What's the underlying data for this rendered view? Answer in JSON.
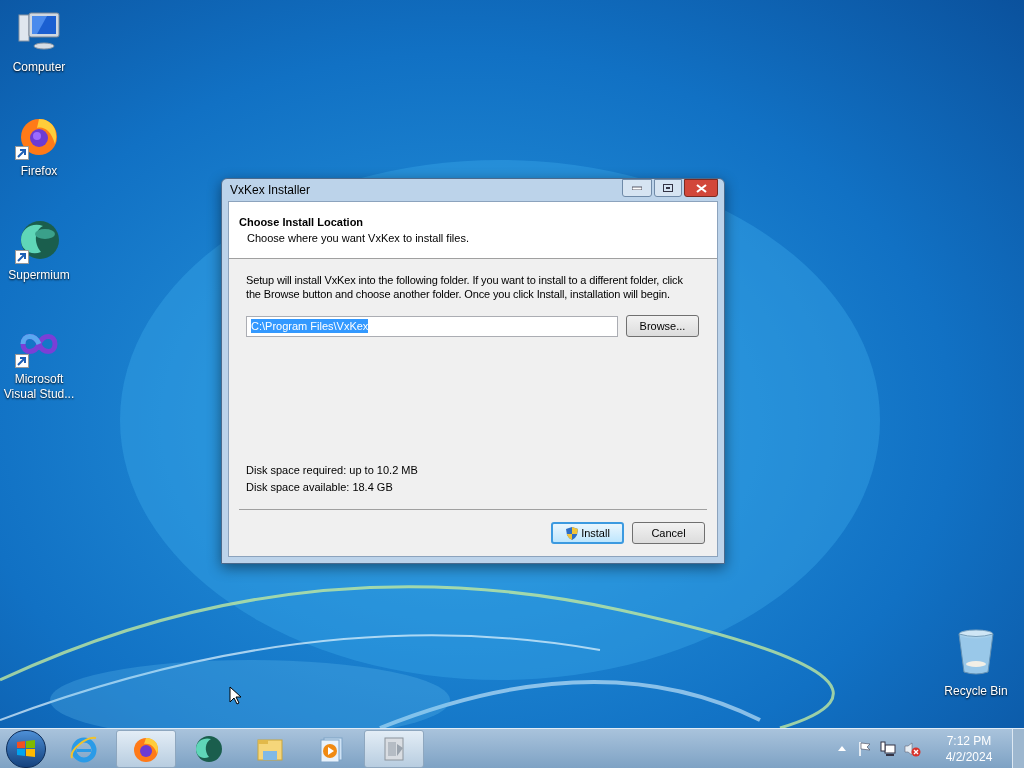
{
  "desktop_icons": [
    {
      "label": "Computer",
      "kind": "computer",
      "shortcut": false
    },
    {
      "label": "Firefox",
      "kind": "firefox",
      "shortcut": true
    },
    {
      "label": "Supermium",
      "kind": "supermium",
      "shortcut": true
    },
    {
      "label": "Microsoft Visual Stud...",
      "kind": "vs",
      "shortcut": true
    }
  ],
  "recycle_bin": {
    "label": "Recycle Bin"
  },
  "window": {
    "title": "VxKex Installer",
    "header": {
      "title": "Choose Install Location",
      "subtitle": "Choose where you want VxKex to install files."
    },
    "body": "Setup will install VxKex into the following folder. If you want to install to a different folder, click the Browse button and choose another folder. Once you click Install, installation will begin.",
    "folder_field": {
      "value": "C:\\Program Files\\VxKex",
      "text_selected": true
    },
    "browse_button": "Browse...",
    "disk_required": "Disk space required: up to 10.2 MB",
    "disk_available": "Disk space available: 18.4 GB",
    "buttons": [
      {
        "label": "Install",
        "kind": "shield",
        "default": true
      },
      {
        "label": "Cancel",
        "kind": "plain",
        "default": false
      }
    ]
  },
  "taskbar": {
    "items": [
      {
        "kind": "ie",
        "running": false
      },
      {
        "kind": "firefox",
        "running": true
      },
      {
        "kind": "supermium",
        "running": false
      },
      {
        "kind": "explorer",
        "running": false
      },
      {
        "kind": "media",
        "running": false
      },
      {
        "kind": "installer",
        "running": true
      }
    ],
    "tray": {
      "time": "7:12 PM",
      "date": "4/2/2024"
    }
  }
}
